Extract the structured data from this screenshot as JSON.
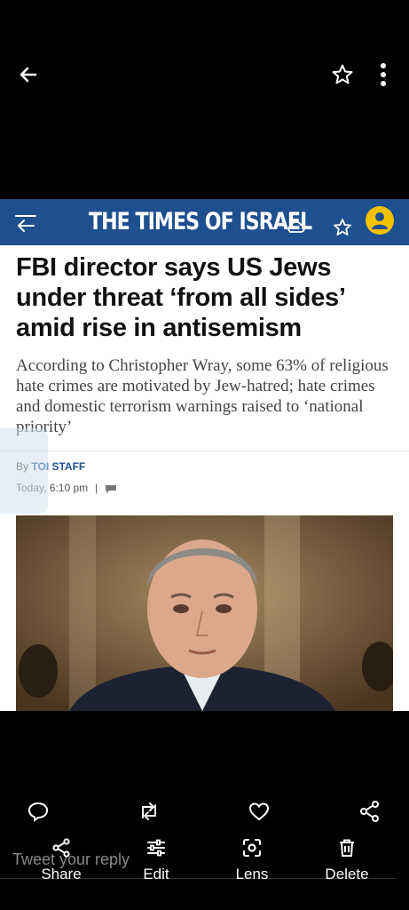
{
  "viewer": {
    "icons": [
      "back-arrow-icon",
      "star-icon",
      "more-vertical-icon"
    ]
  },
  "masthead": {
    "brand": "THE TIMES OF ISRAEL",
    "bg_color": "#1e4f8e",
    "accent_color": "#f2c200"
  },
  "article": {
    "headline": "FBI director says US Jews under threat ‘from all sides’ amid rise in antisemism",
    "dek": "According to Christopher Wray, some 63% of religious hate crimes are motivated by Jew-hatred; hate crimes and domestic terrorism warnings raised to ‘national priority’",
    "byline_prefix": "By",
    "byline_name": "TOI STAFF",
    "time": "Today, 6:10 pm",
    "separator": "|"
  },
  "social": {
    "icons": [
      "reply-icon",
      "retweet-icon",
      "like-icon",
      "share-network-icon"
    ],
    "tweet_placeholder": "Tweet your reply"
  },
  "actions": [
    {
      "label": "Share",
      "icon": "share-icon"
    },
    {
      "label": "Edit",
      "icon": "sliders-icon"
    },
    {
      "label": "Lens",
      "icon": "lens-icon"
    },
    {
      "label": "Delete",
      "icon": "trash-icon"
    }
  ]
}
